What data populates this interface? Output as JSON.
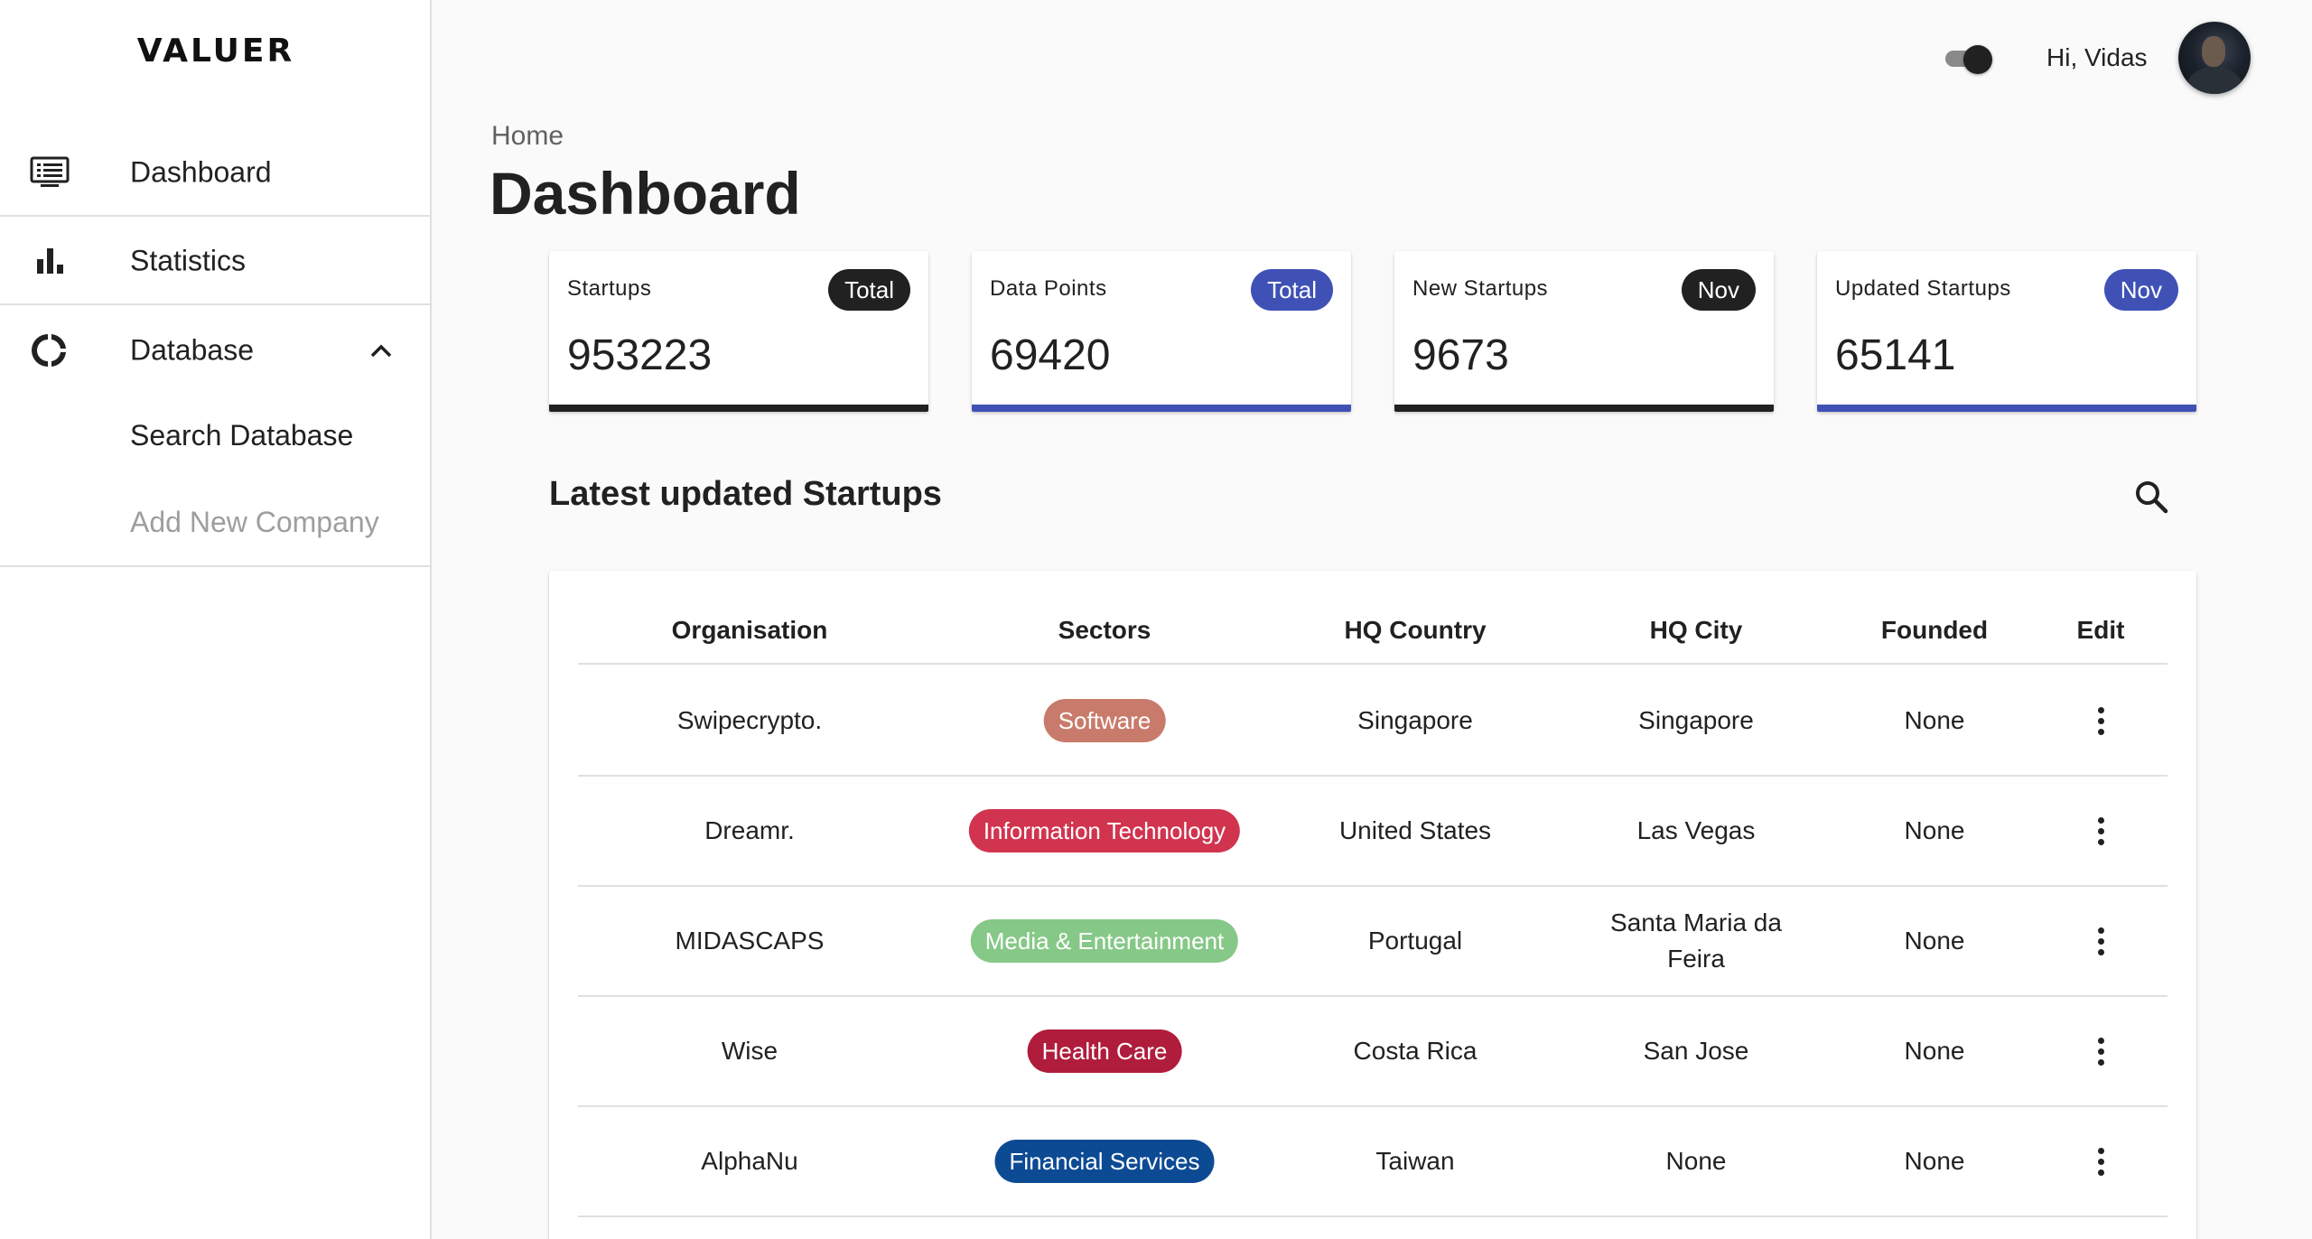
{
  "app": {
    "logo": "VALUER"
  },
  "sidebar": {
    "items": [
      {
        "label": "Dashboard",
        "icon": "dashboard-icon"
      },
      {
        "label": "Statistics",
        "icon": "bar-chart-icon"
      },
      {
        "label": "Database",
        "icon": "donut-icon",
        "expanded": true,
        "children": [
          {
            "label": "Search Database"
          },
          {
            "label": "Add New Company"
          }
        ]
      }
    ]
  },
  "topbar": {
    "greeting": "Hi, Vidas",
    "dark_mode_toggle": "on"
  },
  "header": {
    "breadcrumb": "Home",
    "title": "Dashboard"
  },
  "stats": [
    {
      "label": "Startups",
      "badge": "Total",
      "value": "953223",
      "accent": "#212121"
    },
    {
      "label": "Data Points",
      "badge": "Total",
      "value": "69420",
      "accent": "#3f51b5"
    },
    {
      "label": "New Startups",
      "badge": "Nov",
      "value": "9673",
      "accent": "#212121"
    },
    {
      "label": "Updated Startups",
      "badge": "Nov",
      "value": "65141",
      "accent": "#3f51b5"
    }
  ],
  "section": {
    "title": "Latest updated Startups"
  },
  "table": {
    "columns": [
      "Organisation",
      "Sectors",
      "HQ Country",
      "HQ City",
      "Founded",
      "Edit"
    ],
    "rows": [
      {
        "organisation": "Swipecrypto.",
        "sector": "Software",
        "sector_color": "#c97b6b",
        "country": "Singapore",
        "city": "Singapore",
        "founded": "None"
      },
      {
        "organisation": "Dreamr.",
        "sector": "Information Technology",
        "sector_color": "#d1344f",
        "country": "United States",
        "city": "Las Vegas",
        "founded": "None"
      },
      {
        "organisation": "MIDASCAPS",
        "sector": "Media & Entertainment",
        "sector_color": "#86c887",
        "country": "Portugal",
        "city": "Santa Maria da Feira",
        "founded": "None"
      },
      {
        "organisation": "Wise",
        "sector": "Health Care",
        "sector_color": "#b01c3c",
        "country": "Costa Rica",
        "city": "San Jose",
        "founded": "None"
      },
      {
        "organisation": "AlphaNu",
        "sector": "Financial Services",
        "sector_color": "#0d4a94",
        "country": "Taiwan",
        "city": "None",
        "founded": "None"
      }
    ]
  },
  "colors": {
    "primary": "#3f51b5",
    "dark": "#212121",
    "background": "#fafafa"
  }
}
